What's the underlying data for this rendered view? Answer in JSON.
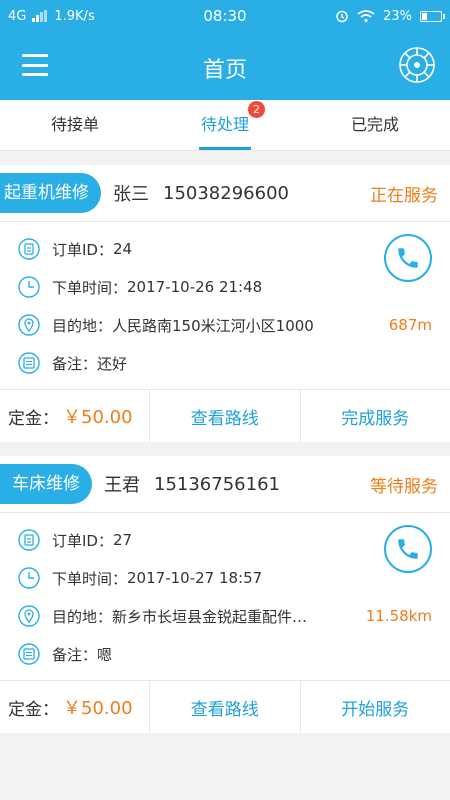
{
  "status_bar": {
    "network": "4G",
    "speed": "1.9K/s",
    "time": "08:30",
    "battery": "23%",
    "battery_level": 0.23
  },
  "header": {
    "title": "首页",
    "menu_icon": "hamburger-icon",
    "settings_icon": "settings-wheel-icon"
  },
  "tabs": [
    {
      "label": "待接单"
    },
    {
      "label": "待处理",
      "badge": "2",
      "active": true
    },
    {
      "label": "已完成"
    }
  ],
  "orders": [
    {
      "service_type": "起重机维修",
      "customer_name": "张三",
      "customer_phone": "15038296600",
      "status": "正在服务",
      "order_id_label": "订单ID：",
      "order_id": "24",
      "time_label": "下单时间：",
      "order_time": "2017-10-26 21:48",
      "dest_label": "目的地：",
      "destination": "人民路南150米江河小区1000",
      "distance": "687m",
      "note_label": "备注：",
      "note": "还好",
      "deposit_label": "定金：",
      "deposit": "￥50.00",
      "route_btn": "查看路线",
      "action_btn": "完成服务"
    },
    {
      "service_type": "车床维修",
      "customer_name": "王君",
      "customer_phone": "15136756161",
      "status": "等待服务",
      "order_id_label": "订单ID：",
      "order_id": "27",
      "time_label": "下单时间：",
      "order_time": "2017-10-27 18:57",
      "dest_label": "目的地：",
      "destination": "新乡市长垣县金锐起重配件…",
      "distance": "11.58km",
      "note_label": "备注：",
      "note": "嗯",
      "deposit_label": "定金：",
      "deposit": "￥50.00",
      "route_btn": "查看路线",
      "action_btn": "开始服务"
    }
  ],
  "colors": {
    "primary": "#29aee6",
    "accent": "#ef7d1a",
    "badge": "#f04a3c"
  }
}
